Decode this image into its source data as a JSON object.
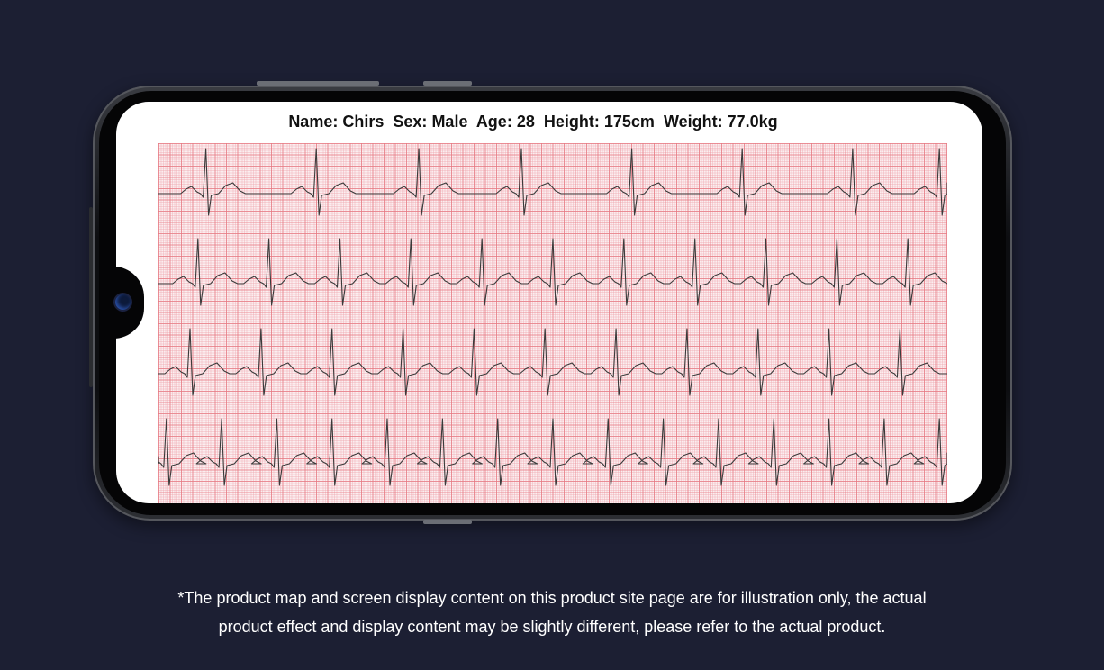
{
  "patient": {
    "name_label": "Name:",
    "name": "Chirs",
    "sex_label": "Sex:",
    "sex": "Male",
    "age_label": "Age:",
    "age": "28",
    "height_label": "Height:",
    "height": "175cm",
    "weight_label": "Weight:",
    "weight": "77.0kg"
  },
  "ecg": {
    "trace_color": "#3a3a3a",
    "grid_major_color": "#e6787f",
    "grid_minor_color": "#f0aab2",
    "leads": [
      {
        "beats": [
          0.06,
          0.2,
          0.33,
          0.46,
          0.6,
          0.74,
          0.88,
          0.99
        ]
      },
      {
        "beats": [
          0.05,
          0.14,
          0.23,
          0.32,
          0.41,
          0.5,
          0.59,
          0.68,
          0.77,
          0.86,
          0.95
        ]
      },
      {
        "beats": [
          0.04,
          0.13,
          0.22,
          0.31,
          0.4,
          0.49,
          0.58,
          0.67,
          0.76,
          0.85,
          0.94
        ]
      },
      {
        "beats": [
          0.01,
          0.08,
          0.15,
          0.22,
          0.29,
          0.36,
          0.43,
          0.5,
          0.57,
          0.64,
          0.71,
          0.78,
          0.85,
          0.92,
          0.99
        ]
      }
    ]
  },
  "footnote": {
    "line1": "*The product map and screen display content on this product site page are for illustration only, the actual",
    "line2": "product effect and display content may be slightly different, please refer to the actual product."
  }
}
